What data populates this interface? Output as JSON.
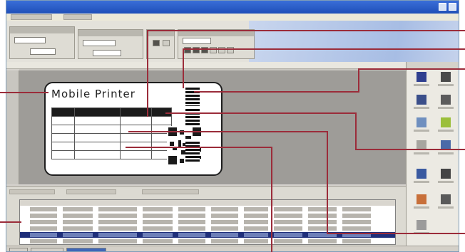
{
  "label": {
    "title": "Mobile Printer"
  },
  "colors": {
    "callout_line": "#9b2c3a",
    "titlebar": "#2a5cc9",
    "selected_row": "#1f2f7a"
  },
  "icons": {
    "object_panel": [
      "text-object-icon",
      "barcode-object-icon",
      "image-object-icon",
      "shape-object-icon",
      "table-object-icon",
      "note-object-icon",
      "line-object-icon",
      "date-object-icon",
      "user-object-icon",
      "printer-object-icon",
      "counter-object-icon"
    ]
  }
}
